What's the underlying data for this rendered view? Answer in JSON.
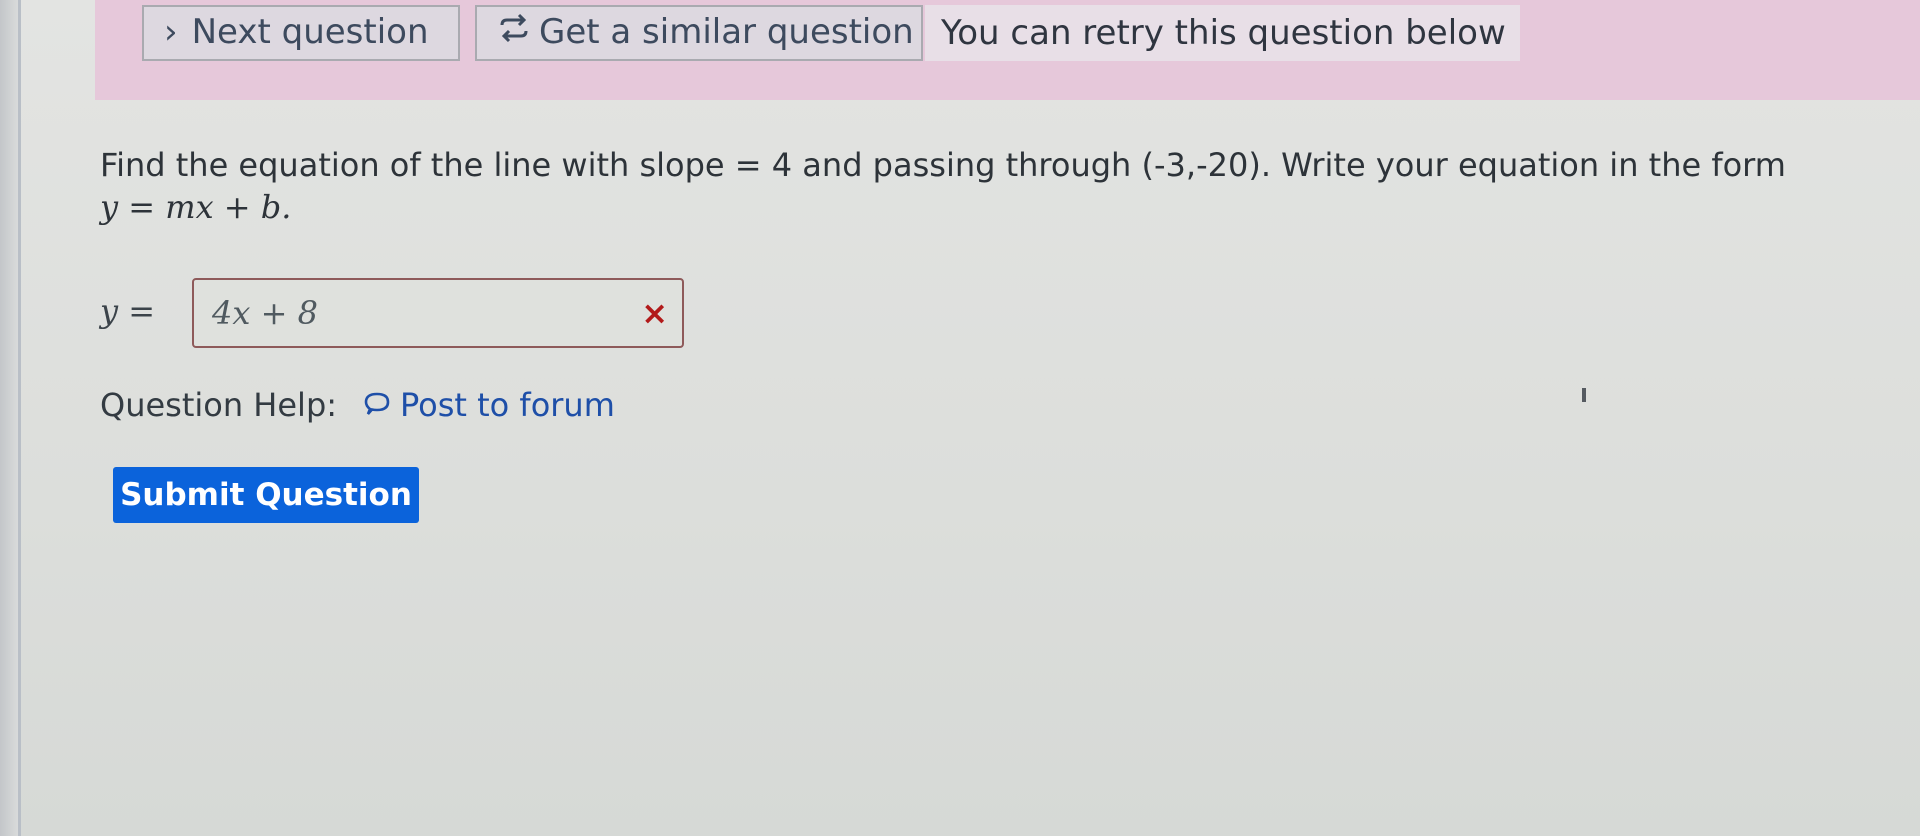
{
  "banner": {
    "next_label": "Next question",
    "next_icon": "chevron-right-icon",
    "similar_label": "Get a similar question",
    "similar_icon": "retry-arrows-icon",
    "retry_text": "You can retry this question below"
  },
  "question": {
    "text": "Find the equation of the line with slope = 4 and passing through (-3,-20). Write your equation in the form",
    "formula": "y = mx + b."
  },
  "answer": {
    "prefix": "y =",
    "value": "4x + 8",
    "status_mark": "×",
    "status": "incorrect"
  },
  "help": {
    "label": "Question Help:",
    "forum_label": "Post to forum",
    "forum_icon": "speech-bubble-icon"
  },
  "submit": {
    "label": "Submit Question"
  },
  "colors": {
    "banner_bg": "#e6c8da",
    "submit_bg": "#0b63db",
    "link": "#1e4fa8",
    "error": "#b21a1a"
  }
}
